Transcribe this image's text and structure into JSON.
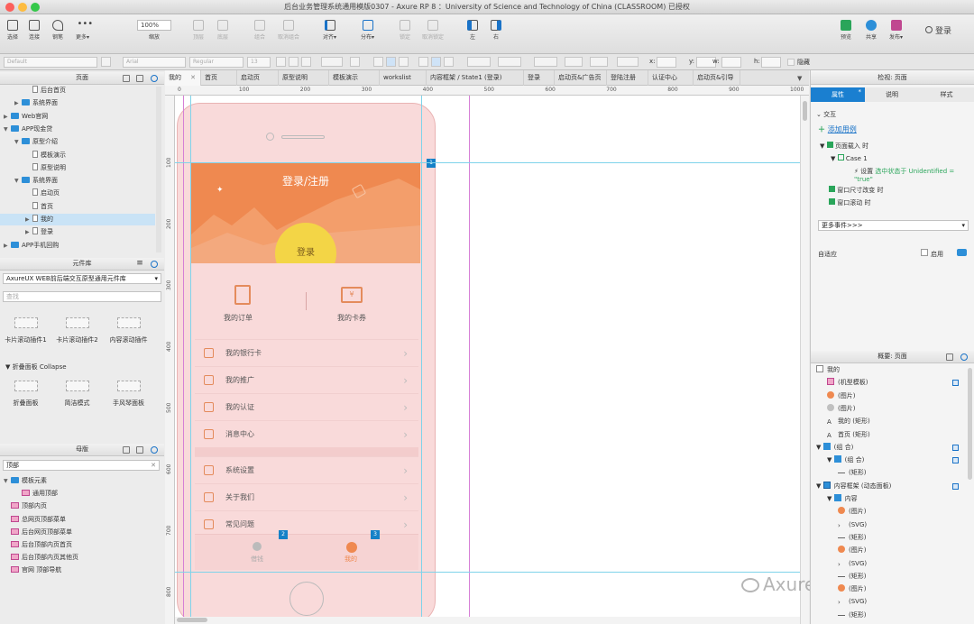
{
  "window": {
    "title": "后台业务管理系统通用模版0307 - Axure RP 8 ：University of Science and Technology of China (CLASSROOM) 已授权"
  },
  "toolbar": {
    "select": "选择",
    "connect": "连接",
    "pen": "钢笔",
    "more": "更多▾",
    "zoom": "100%",
    "zoom_label": "缩放",
    "top": "顶层",
    "bottom": "底层",
    "group": "组合",
    "ungroup": "取消组合",
    "align": "对齐▾",
    "distribute": "分布▾",
    "lock": "锁定",
    "unlock": "取消锁定",
    "left": "左",
    "right": "右",
    "preview": "预览",
    "share": "共享",
    "publish": "发布▾",
    "login": "登录"
  },
  "format": {
    "style": "Default",
    "font": "Arial",
    "weight": "Regular",
    "size": "13",
    "x": "x:",
    "y": "y:",
    "w": "w:",
    "h": "h:",
    "hide": "隐藏"
  },
  "pages_panel": {
    "title": "页面",
    "items": [
      {
        "label": "后台首页",
        "indent": 3,
        "type": "page",
        "arrow": ""
      },
      {
        "label": "系统界面",
        "indent": 2,
        "type": "folder",
        "arrow": "▶"
      },
      {
        "label": "Web官网",
        "indent": 1,
        "type": "folder",
        "arrow": "▶"
      },
      {
        "label": "APP现金贷",
        "indent": 1,
        "type": "folder",
        "arrow": "▼"
      },
      {
        "label": "原型介绍",
        "indent": 2,
        "type": "folder",
        "arrow": "▼"
      },
      {
        "label": "模板演示",
        "indent": 3,
        "type": "page",
        "arrow": ""
      },
      {
        "label": "原型说明",
        "indent": 3,
        "type": "page",
        "arrow": ""
      },
      {
        "label": "系统界面",
        "indent": 2,
        "type": "folder",
        "arrow": "▼"
      },
      {
        "label": "启动页",
        "indent": 3,
        "type": "page",
        "arrow": ""
      },
      {
        "label": "首页",
        "indent": 3,
        "type": "page",
        "arrow": ""
      },
      {
        "label": "我的",
        "indent": 3,
        "type": "page",
        "arrow": "▶",
        "selected": true
      },
      {
        "label": "登录",
        "indent": 3,
        "type": "page",
        "arrow": "▶"
      },
      {
        "label": "APP手机回购",
        "indent": 1,
        "type": "folder",
        "arrow": "▶"
      }
    ]
  },
  "library_panel": {
    "title": "元件库",
    "library": "AxureUX WEB前后端交互原型通用元件库",
    "search_placeholder": "查找",
    "widgets": [
      "卡片滚动插件1",
      "卡片滚动插件2",
      "内容滚动插件"
    ],
    "section": "折叠面板 Collapse",
    "section_widgets": [
      "折叠面板",
      "简洁模式",
      "手风琴面板"
    ]
  },
  "masters_panel": {
    "title": "母版",
    "search": "顶部",
    "items": [
      {
        "label": "模板元素",
        "indent": 1,
        "type": "folder",
        "arrow": "▼"
      },
      {
        "label": "通用顶部",
        "indent": 2,
        "type": "master",
        "arrow": ""
      },
      {
        "label": "顶部内页",
        "indent": 1,
        "type": "master",
        "arrow": ""
      },
      {
        "label": "总网页顶部菜单",
        "indent": 1,
        "type": "master",
        "arrow": ""
      },
      {
        "label": "后台网页顶部菜单",
        "indent": 1,
        "type": "master",
        "arrow": ""
      },
      {
        "label": "后台顶部内页首页",
        "indent": 1,
        "type": "master",
        "arrow": ""
      },
      {
        "label": "后台顶部内页其他页",
        "indent": 1,
        "type": "master",
        "arrow": ""
      },
      {
        "label": "官网 顶部导航",
        "indent": 1,
        "type": "master",
        "arrow": ""
      }
    ]
  },
  "tabs": [
    "我的",
    "首页",
    "启动页",
    "原型说明",
    "模板演示",
    "workslist",
    "内容框架 / State1 (登录)",
    "登录",
    "启动页&广告页",
    "登陆注册",
    "认证中心",
    "启动页&引导页"
  ],
  "hruler": [
    "0",
    "100",
    "200",
    "300",
    "400",
    "500",
    "600",
    "700",
    "800",
    "900",
    "1000"
  ],
  "vruler": [
    "100",
    "200",
    "300",
    "400",
    "500",
    "600",
    "700",
    "800"
  ],
  "phone": {
    "header_title": "登录/注册",
    "login_button": "登录",
    "orders": "我的订单",
    "cards": "我的卡券",
    "menu": [
      "我的银行卡",
      "我的推广",
      "我的认证",
      "消息中心",
      "系统设置",
      "关于我们",
      "常见问题"
    ],
    "tab_borrow": "借钱",
    "tab_mine": "我的",
    "badges": [
      "1",
      "2",
      "3"
    ]
  },
  "right": {
    "title": "检视: 页面",
    "tabs": [
      "属性",
      "说明",
      "样式"
    ],
    "interaction": "交互",
    "add_case": "添加用例",
    "events": {
      "load": "页面载入 时",
      "case1": "Case 1",
      "action": "设置",
      "action_detail": "选中状态于 Unidentified = \"true\"",
      "resize": "窗口尺寸改变 时",
      "scroll": "窗口滚动 时"
    },
    "more_events": "更多事件>>>",
    "adaptive": "自适应",
    "enable": "启用"
  },
  "outline": {
    "title": "概要: 页面",
    "items": [
      {
        "label": "我的",
        "indent": 0,
        "icon": "page",
        "arrow": "",
        "sq": false
      },
      {
        "label": "(机型模板)",
        "indent": 1,
        "icon": "master",
        "arrow": "",
        "sq": true
      },
      {
        "label": "(图片)",
        "indent": 1,
        "icon": "orange",
        "arrow": "",
        "sq": false
      },
      {
        "label": "(图片)",
        "indent": 1,
        "icon": "gray",
        "arrow": "",
        "sq": false
      },
      {
        "label": "我的 (矩形)",
        "indent": 1,
        "icon": "text",
        "arrow": "",
        "sq": false
      },
      {
        "label": "首页 (矩形)",
        "indent": 1,
        "icon": "text",
        "arrow": "",
        "sq": false
      },
      {
        "label": "(组 合)",
        "indent": 0,
        "icon": "folder",
        "arrow": "▼",
        "sq": true
      },
      {
        "label": "(组 合)",
        "indent": 1,
        "icon": "folder",
        "arrow": "▼",
        "sq": true
      },
      {
        "label": "(矩形)",
        "indent": 2,
        "icon": "rect",
        "arrow": "",
        "sq": false
      },
      {
        "label": "内容框架 (动态面板)",
        "indent": 0,
        "icon": "panel",
        "arrow": "▼",
        "sq": true
      },
      {
        "label": "内容",
        "indent": 1,
        "icon": "folder",
        "arrow": "▼",
        "sq": false
      },
      {
        "label": "(图片)",
        "indent": 2,
        "icon": "orange",
        "arrow": "",
        "sq": false
      },
      {
        "label": "(SVG)",
        "indent": 2,
        "icon": "chev",
        "arrow": "",
        "sq": false
      },
      {
        "label": "(矩形)",
        "indent": 2,
        "icon": "rect",
        "arrow": "",
        "sq": false
      },
      {
        "label": "(图片)",
        "indent": 2,
        "icon": "orange",
        "arrow": "",
        "sq": false
      },
      {
        "label": "(SVG)",
        "indent": 2,
        "icon": "chev",
        "arrow": "",
        "sq": false
      },
      {
        "label": "(矩形)",
        "indent": 2,
        "icon": "rect",
        "arrow": "",
        "sq": false
      },
      {
        "label": "(图片)",
        "indent": 2,
        "icon": "orange",
        "arrow": "",
        "sq": false
      },
      {
        "label": "(SVG)",
        "indent": 2,
        "icon": "chev",
        "arrow": "",
        "sq": false
      },
      {
        "label": "(矩形)",
        "indent": 2,
        "icon": "rect",
        "arrow": "",
        "sq": false
      }
    ]
  },
  "watermark": "Axure技术小站",
  "colors": {
    "accent": "#1a73c8",
    "orange": "#ef8950",
    "yellow": "#f3d546",
    "phone_bg": "#f9dada"
  }
}
